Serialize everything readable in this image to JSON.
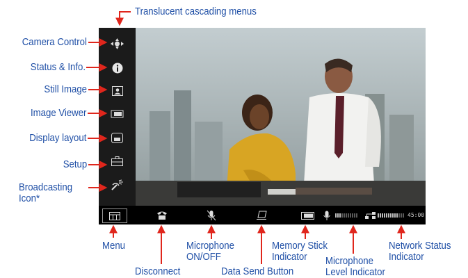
{
  "labels": {
    "translucent_menus": "Translucent cascading menus",
    "camera_control": "Camera Control",
    "status_info": "Status & Info.",
    "still_image": "Still Image",
    "image_viewer": "Image Viewer",
    "display_layout": "Display layout",
    "setup": "Setup",
    "broadcasting_line1": "Broadcasting",
    "broadcasting_line2": "Icon*",
    "menu": "Menu",
    "disconnect": "Disconnect",
    "mic_line1": "Microphone",
    "mic_line2": "ON/OFF",
    "data_send": "Data Send Button",
    "memory_line1": "Memory Stick",
    "memory_line2": "Indicator",
    "mic_level_line1": "Microphone",
    "mic_level_line2": "Level Indicator",
    "network_line1": "Network Status",
    "network_line2": "Indicator"
  },
  "screen": {
    "timecode": "45:00",
    "photo_description_icon": "video-feed"
  },
  "colors": {
    "label_blue": "#1f4fa6",
    "arrow_red": "#e0261c",
    "sidebar": "#1b1b1b",
    "bar": "#000000"
  },
  "icons": {
    "camera_control": "camera-control-icon",
    "status_info": "info-icon",
    "still_image": "still-image-icon",
    "image_viewer": "image-viewer-icon",
    "display_layout": "display-layout-icon",
    "setup": "setup-icon",
    "broadcasting": "broadcasting-icon",
    "menu": "menu-icon",
    "disconnect": "phone-icon",
    "microphone": "microphone-muted-icon",
    "data_send": "data-send-icon",
    "memory_stick": "memory-stick-icon",
    "mic_level": "mic-level-icon",
    "network": "network-icon"
  }
}
